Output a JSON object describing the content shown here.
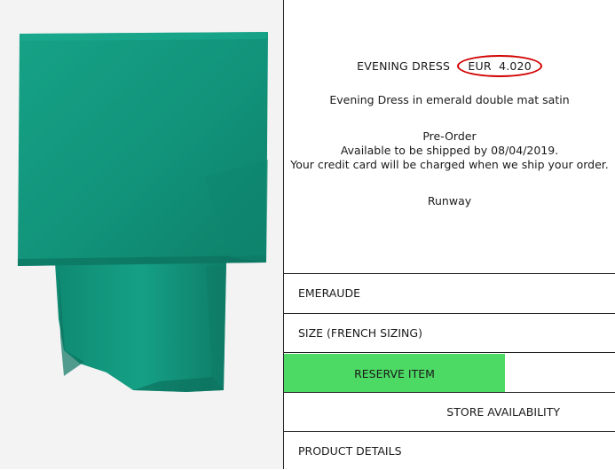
{
  "product": {
    "name": "EVENING DRESS",
    "price": "EUR  4.020",
    "description": "Evening Dress in emerald double mat satin",
    "preorder": {
      "heading": "Pre-Order",
      "ship_line": "Available to be shipped by 08/04/2019.",
      "charge_line": "Your credit card will be charged when we ship your order."
    },
    "collection": "Runway"
  },
  "options": {
    "color": "EMERAUDE",
    "size": "SIZE (FRENCH SIZING)"
  },
  "actions": {
    "reserve": "RESERVE ITEM",
    "store": "STORE AVAILABILITY",
    "details": "PRODUCT DETAILS"
  },
  "colors": {
    "fabric": "#13977e",
    "reserve_button": "#4cd964",
    "price_highlight": "#d10000"
  }
}
